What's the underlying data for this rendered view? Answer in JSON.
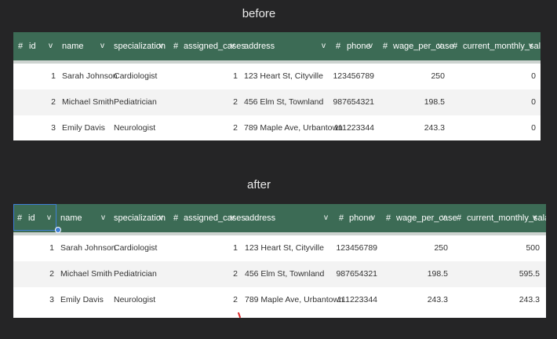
{
  "labels": {
    "before": "before",
    "after": "after"
  },
  "columns": [
    {
      "key": "id",
      "label": "id",
      "typed": true
    },
    {
      "key": "name",
      "label": "name",
      "typed": false
    },
    {
      "key": "specialization",
      "label": "specialization",
      "typed": false
    },
    {
      "key": "assigned_cases",
      "label": "assigned_cases",
      "typed": true
    },
    {
      "key": "address",
      "label": "address",
      "typed": false
    },
    {
      "key": "phone",
      "label": "phone",
      "typed": true
    },
    {
      "key": "wage_per_case",
      "label": "wage_per_case",
      "typed": true
    },
    {
      "key": "current_monthly_salary",
      "label": "current_monthly_salary",
      "typed": true
    }
  ],
  "symbols": {
    "hash": "#",
    "chevron": "v"
  },
  "before": {
    "rows": [
      {
        "id": "1",
        "name": "Sarah Johnson",
        "specialization": "Cardiologist",
        "assigned_cases": "1",
        "address": "123 Heart St, Cityville",
        "phone": "123456789",
        "wage_per_case": "250",
        "current_monthly_salary": "0"
      },
      {
        "id": "2",
        "name": "Michael Smith",
        "specialization": "Pediatrician",
        "assigned_cases": "2",
        "address": "456 Elm St, Townland",
        "phone": "987654321",
        "wage_per_case": "198.5",
        "current_monthly_salary": "0"
      },
      {
        "id": "3",
        "name": "Emily Davis",
        "specialization": "Neurologist",
        "assigned_cases": "2",
        "address": "789 Maple Ave, Urbantown",
        "phone": "111223344",
        "wage_per_case": "243.3",
        "current_monthly_salary": "0"
      }
    ]
  },
  "after": {
    "rows": [
      {
        "id": "1",
        "name": "Sarah Johnson",
        "specialization": "Cardiologist",
        "assigned_cases": "1",
        "address": "123 Heart St, Cityville",
        "phone": "123456789",
        "wage_per_case": "250",
        "current_monthly_salary": "500"
      },
      {
        "id": "2",
        "name": "Michael Smith",
        "specialization": "Pediatrician",
        "assigned_cases": "2",
        "address": "456 Elm St, Townland",
        "phone": "987654321",
        "wage_per_case": "198.5",
        "current_monthly_salary": "595.5"
      },
      {
        "id": "3",
        "name": "Emily Davis",
        "specialization": "Neurologist",
        "assigned_cases": "2",
        "address": "789 Maple Ave, Urbantown",
        "phone": "111223344",
        "wage_per_case": "243.3",
        "current_monthly_salary": "243.3"
      }
    ]
  }
}
